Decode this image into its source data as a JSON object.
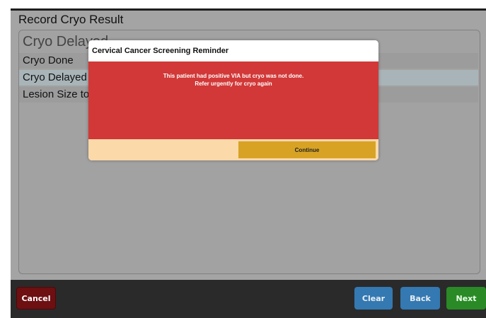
{
  "page": {
    "title": "Record Cryo Result"
  },
  "selector": {
    "selected_value": "Cryo Delayed",
    "options": [
      {
        "label": "Cryo Done"
      },
      {
        "label": "Cryo Delayed"
      },
      {
        "label": "Lesion Size too"
      }
    ]
  },
  "modal": {
    "title": "Cervical Cancer Screening Reminder",
    "message_line1": "This patient had positive VIA but cryo was not done.",
    "message_line2": "Refer urgently for cryo again",
    "continue_label": "Continue"
  },
  "footer": {
    "cancel_label": "Cancel",
    "clear_label": "Clear",
    "back_label": "Back",
    "next_label": "Next"
  },
  "colors": {
    "modal_body": "#d13837",
    "modal_footer": "#fbd9a9",
    "continue_button": "#d8a325",
    "cancel_button": "#6e0f12",
    "nav_button": "#3479b1",
    "next_button": "#2a8a26"
  }
}
